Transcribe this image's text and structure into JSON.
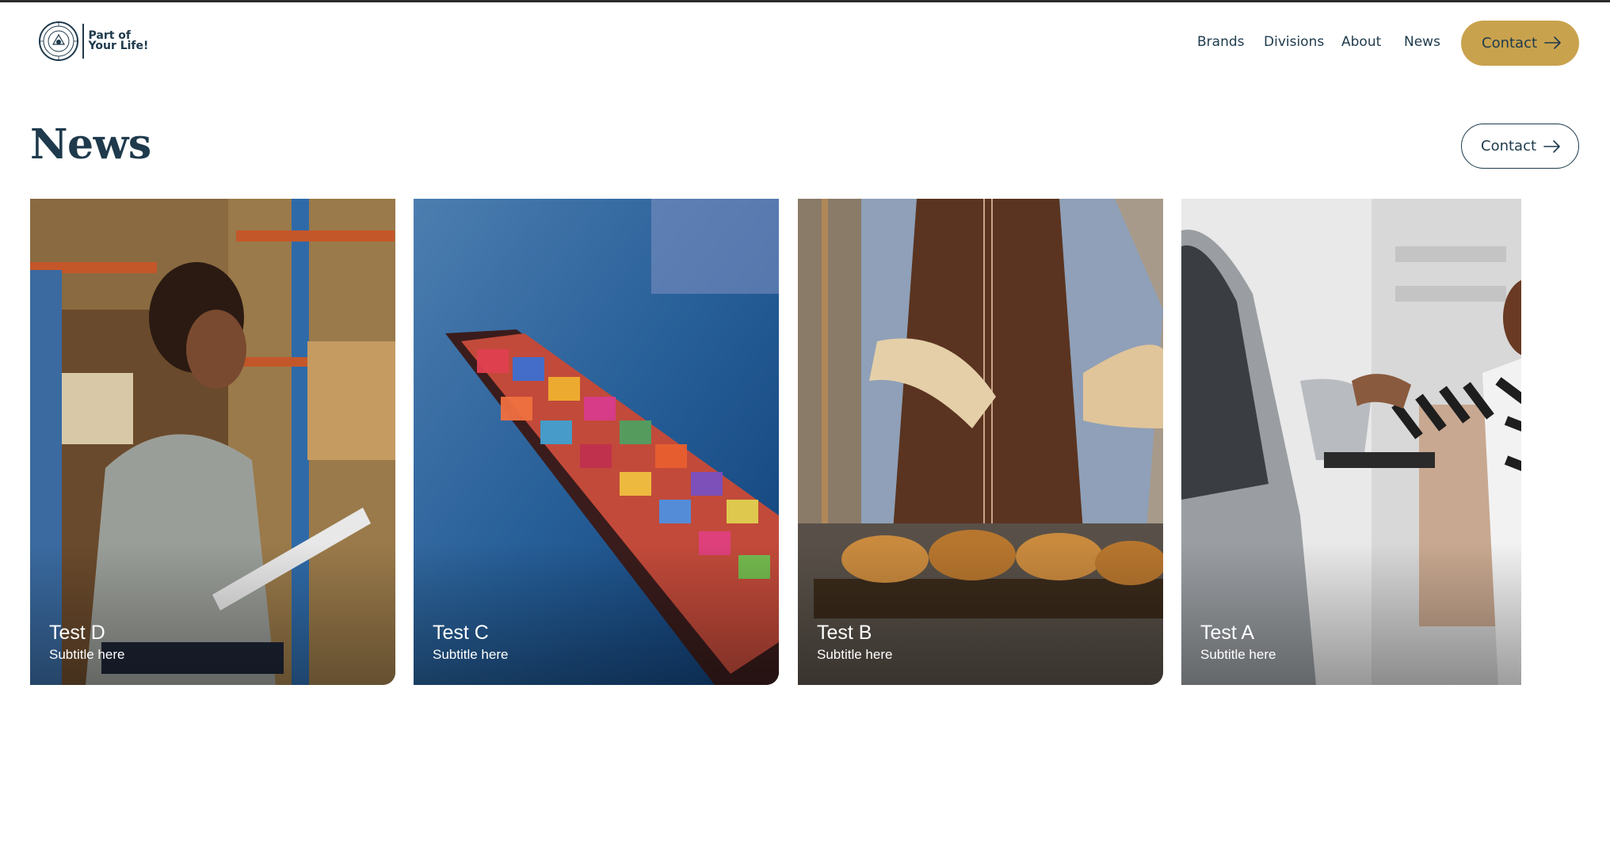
{
  "header": {
    "logo_line1": "Part of",
    "logo_line2": "Your Life!",
    "nav": [
      "Brands",
      "Divisions",
      "About",
      "News"
    ],
    "contact_label": "Contact"
  },
  "main": {
    "title": "News",
    "contact_label": "Contact",
    "cards": [
      {
        "title": "Test D",
        "subtitle": "Subtitle here",
        "image": "warehouse-worker-photo"
      },
      {
        "title": "Test C",
        "subtitle": "Subtitle here",
        "image": "cargo-ship-photo"
      },
      {
        "title": "Test B",
        "subtitle": "Subtitle here",
        "image": "baker-bread-photo"
      },
      {
        "title": "Test A",
        "subtitle": "Subtitle here",
        "image": "car-mirror-photo"
      }
    ]
  },
  "colors": {
    "brand_navy": "#1e3a4c",
    "accent_gold": "#c9a24d"
  },
  "icons": [
    "seal-logo-icon",
    "arrow-right-icon"
  ]
}
